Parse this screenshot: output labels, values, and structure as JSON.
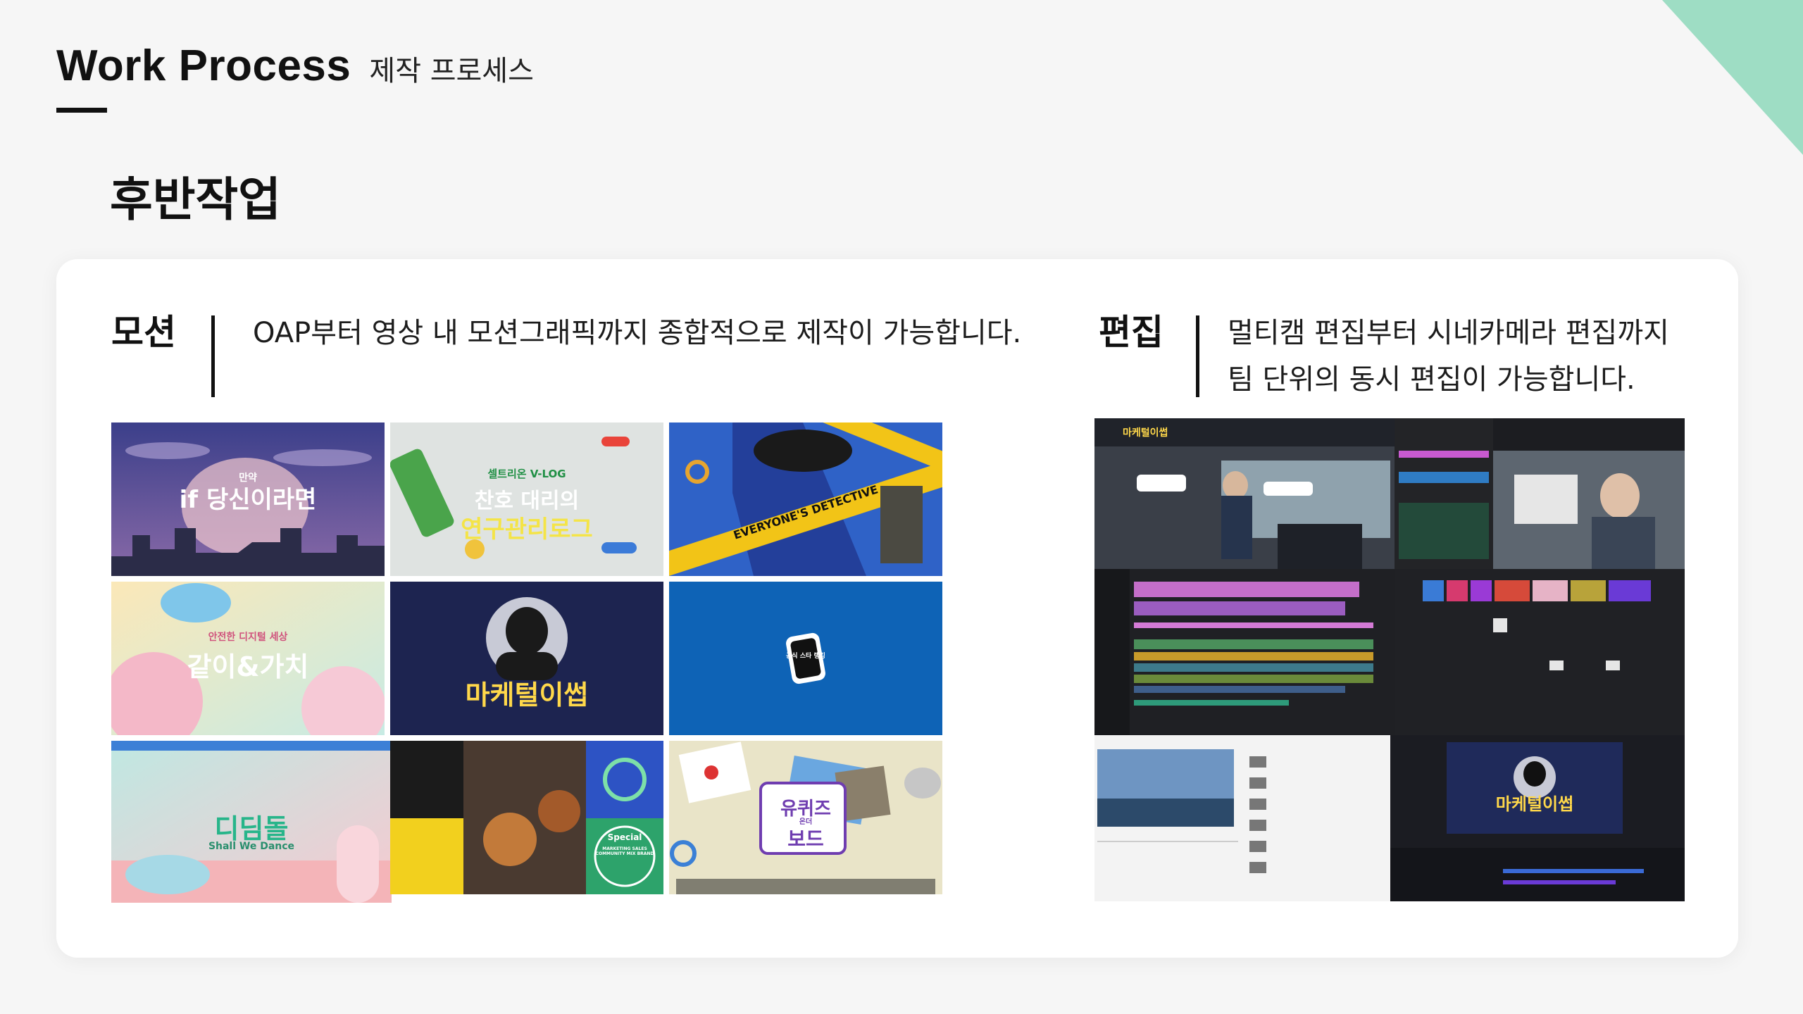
{
  "page": {
    "title_en": "Work Process",
    "title_ko": "제작 프로세스",
    "section_title": "후반작업",
    "accent_color": "#8ed8bb"
  },
  "motion": {
    "label": "모션",
    "description": "OAP부터 영상 내 모션그래픽까지 종합적으로 제작이 가능합니다."
  },
  "editing": {
    "label": "편집",
    "description": "멀티캠 편집부터 시네카메라 편집까지\n팀 단위의 동시 편집이 가능합니다."
  },
  "thumbnails": [
    {
      "small": "만약",
      "title": "if 당신이라면"
    },
    {
      "small": "셀트리온 V-LOG",
      "title": "찬호 대리의",
      "subtitle": "연구관리로그"
    },
    {
      "title": "EVERYONE'S DETECTIVE"
    },
    {
      "small": "안전한 디지털 세상",
      "title": "같이&가치"
    },
    {
      "title": "마케털이썹"
    },
    {
      "title": "공식 스타 랭킹"
    },
    {
      "title": "디딤돌",
      "subtitle": "Shall We Dance"
    },
    {
      "title": "Special",
      "subtitle": "MARKETING SALES COMMUNITY MIX BRAND"
    },
    {
      "title": "유퀴즈",
      "subtitle": "보드",
      "small": "온더"
    }
  ],
  "editing_screens": {
    "panel_title": "마케털이썹",
    "video_title": "마케털이썹"
  }
}
